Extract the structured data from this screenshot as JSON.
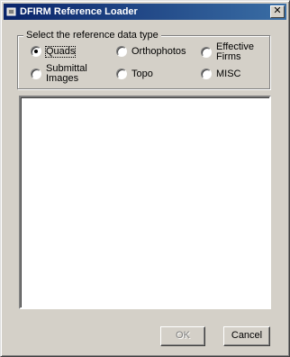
{
  "window": {
    "title": "DFIRM Reference Loader",
    "close_glyph": "✕"
  },
  "group": {
    "label": "Select the reference data type",
    "options": [
      {
        "label": "Quads",
        "checked": true
      },
      {
        "label": "Orthophotos",
        "checked": false
      },
      {
        "label": "Effective Firms",
        "checked": false
      },
      {
        "label": "Submittal Images",
        "checked": false
      },
      {
        "label": "Topo",
        "checked": false
      },
      {
        "label": "MISC",
        "checked": false
      }
    ]
  },
  "buttons": {
    "ok_label": "OK",
    "ok_enabled": false,
    "cancel_label": "Cancel"
  },
  "colors": {
    "title_start": "#0a246a",
    "title_end": "#3a6ea5",
    "face": "#d4d0c8"
  }
}
